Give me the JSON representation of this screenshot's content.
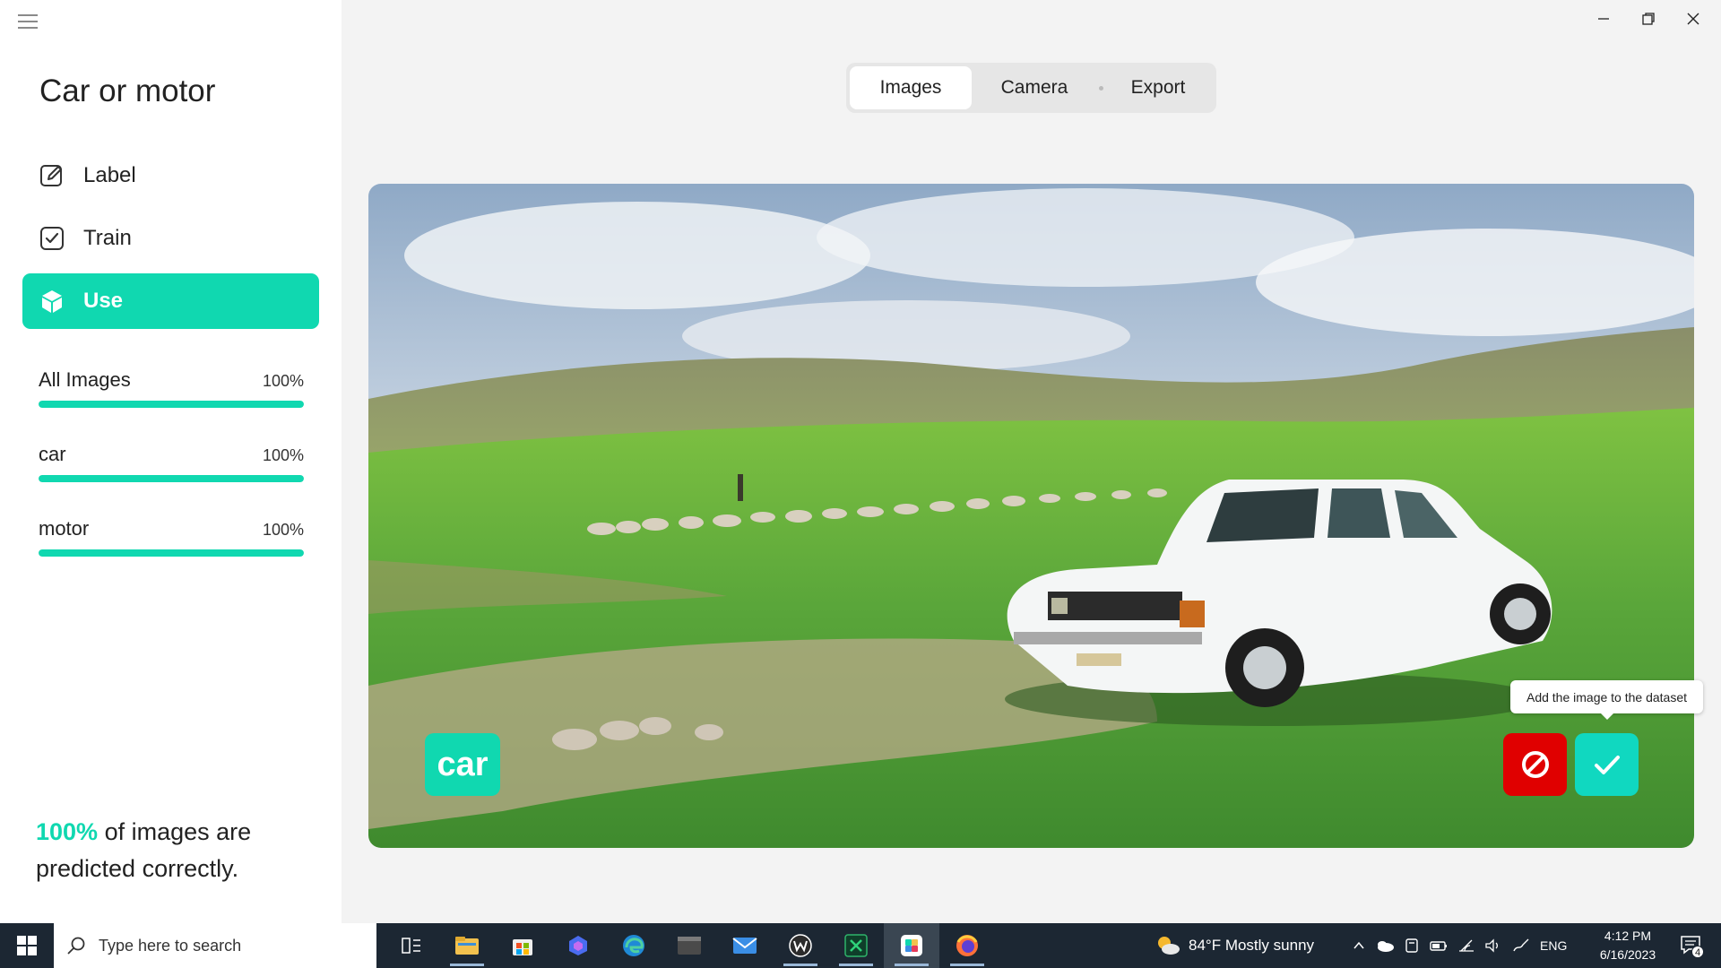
{
  "app": {
    "title": "Car or motor"
  },
  "nav": [
    {
      "label": "Label",
      "icon": "edit-icon"
    },
    {
      "label": "Train",
      "icon": "checkbox-icon"
    },
    {
      "label": "Use",
      "icon": "cube-icon",
      "active": true
    }
  ],
  "stats": [
    {
      "name": "All Images",
      "percent_label": "100%",
      "progress": 1.0
    },
    {
      "name": "car",
      "percent_label": "100%",
      "progress": 1.0
    },
    {
      "name": "motor",
      "percent_label": "100%",
      "progress": 1.0
    }
  ],
  "summary": {
    "percent": "100%",
    "text_line1": " of images are",
    "text_line2": "predicted correctly."
  },
  "tabs": [
    "Images",
    "Camera",
    "Export"
  ],
  "active_tab": "Images",
  "preview": {
    "prediction": "car",
    "tooltip": "Add the image to the dataset",
    "reject_icon": "block-icon",
    "accept_icon": "check-icon"
  },
  "colors": {
    "accent": "#10d8b0",
    "reject": "#e00000",
    "taskbar": "#1c2733"
  },
  "taskbar": {
    "search_placeholder": "Type here to search",
    "apps": [
      "task-view-icon",
      "file-explorer-icon",
      "store-icon",
      "app-icon",
      "edge-icon",
      "terminal-icon",
      "mail-icon",
      "w-app-icon",
      "excel-icon",
      "teachable-app-icon",
      "firefox-icon"
    ],
    "weather": "84°F  Mostly sunny",
    "language": "ENG",
    "time": "4:12 PM",
    "date": "6/16/2023",
    "notifications": "4"
  }
}
